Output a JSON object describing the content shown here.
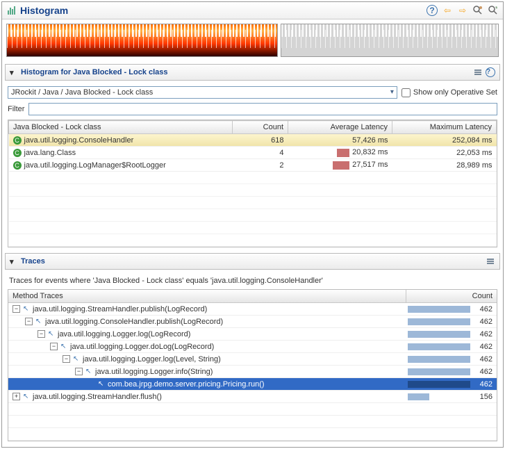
{
  "header": {
    "title": "Histogram"
  },
  "section1": {
    "title": "Histogram for Java Blocked - Lock class",
    "breadcrumb": "JRockit / Java / Java Blocked - Lock class",
    "show_operative_label": "Show only Operative Set",
    "filter_label": "Filter",
    "filter_value": ""
  },
  "histogram_table": {
    "headers": {
      "class": "Java Blocked - Lock class",
      "count": "Count",
      "avg": "Average Latency",
      "max": "Maximum Latency"
    },
    "rows": [
      {
        "class": "java.util.logging.ConsoleHandler",
        "count": "618",
        "avg": "57,426 ms",
        "max": "252,084 ms",
        "bar": 0
      },
      {
        "class": "java.lang.Class",
        "count": "4",
        "avg": "20,832 ms",
        "max": "22,053 ms",
        "bar": 18
      },
      {
        "class": "java.util.logging.LogManager$RootLogger",
        "count": "2",
        "avg": "27,517 ms",
        "max": "28,989 ms",
        "bar": 24
      }
    ]
  },
  "section2": {
    "title": "Traces",
    "description": "Traces for events where 'Java Blocked - Lock class' equals 'java.util.logging.ConsoleHandler'"
  },
  "traces_table": {
    "headers": {
      "method": "Method Traces",
      "count": "Count"
    },
    "rows": [
      {
        "depth": 0,
        "exp": "-",
        "method": "java.util.logging.StreamHandler.publish(LogRecord)",
        "count": "462",
        "pct": 100,
        "selected": false
      },
      {
        "depth": 1,
        "exp": "-",
        "method": "java.util.logging.ConsoleHandler.publish(LogRecord)",
        "count": "462",
        "pct": 100,
        "selected": false
      },
      {
        "depth": 2,
        "exp": "-",
        "method": "java.util.logging.Logger.log(LogRecord)",
        "count": "462",
        "pct": 100,
        "selected": false
      },
      {
        "depth": 3,
        "exp": "-",
        "method": "java.util.logging.Logger.doLog(LogRecord)",
        "count": "462",
        "pct": 100,
        "selected": false
      },
      {
        "depth": 4,
        "exp": "-",
        "method": "java.util.logging.Logger.log(Level, String)",
        "count": "462",
        "pct": 100,
        "selected": false
      },
      {
        "depth": 5,
        "exp": "-",
        "method": "java.util.logging.Logger.info(String)",
        "count": "462",
        "pct": 100,
        "selected": false
      },
      {
        "depth": 6,
        "exp": "",
        "method": "com.bea.jrpg.demo.server.pricing.Pricing.run()",
        "count": "462",
        "pct": 100,
        "selected": true
      },
      {
        "depth": 0,
        "exp": "+",
        "method": "java.util.logging.StreamHandler.flush()",
        "count": "156",
        "pct": 34,
        "selected": false
      }
    ]
  },
  "chart_data": {
    "type": "bar",
    "title": "Histogram — Java Blocked - Lock class",
    "categories": [
      "java.util.logging.ConsoleHandler",
      "java.lang.Class",
      "java.util.logging.LogManager$RootLogger"
    ],
    "series": [
      {
        "name": "Count",
        "values": [
          618,
          4,
          2
        ]
      },
      {
        "name": "Average Latency (ms)",
        "values": [
          57426,
          20832,
          27517
        ]
      },
      {
        "name": "Maximum Latency (ms)",
        "values": [
          252084,
          22053,
          28989
        ]
      }
    ],
    "xlabel": "Lock class",
    "ylabel": ""
  }
}
